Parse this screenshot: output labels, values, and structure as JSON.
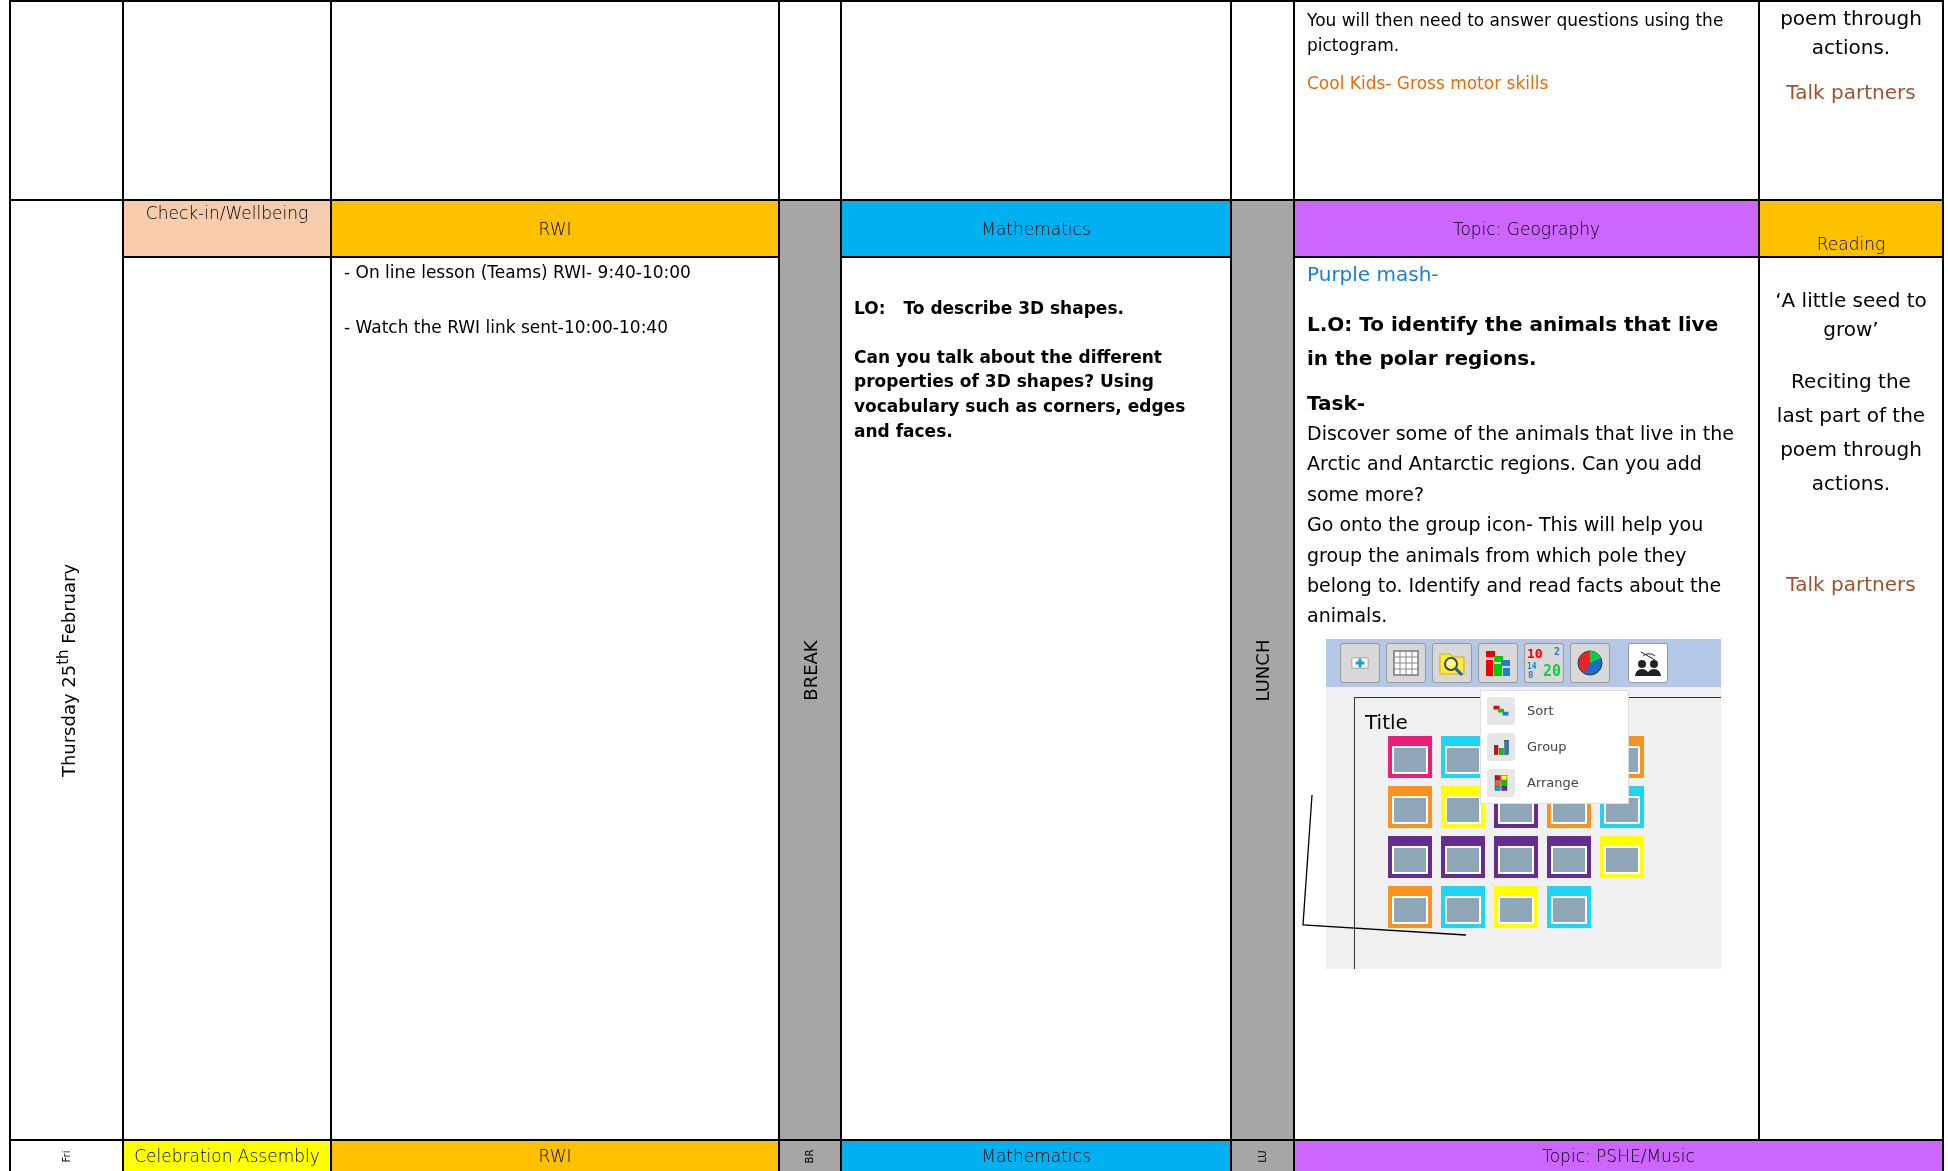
{
  "previous_row": {
    "topic_lines": [
      {
        "text": "You will then need to answer questions using the pictogram.",
        "kind": "plain"
      },
      {
        "text": "Cool Kids- Gross motor skills",
        "kind": "orange"
      }
    ],
    "reading_lines": [
      {
        "text": "poem through actions.",
        "kind": "plain"
      },
      {
        "text": "Talk partners",
        "kind": "brown"
      }
    ]
  },
  "thursday": {
    "day": "Thursday 25$^{th}$ February",
    "check_in": {
      "heading": "Check-in/Wellbeing"
    },
    "rwi": {
      "heading": "RWI",
      "lines": [
        "- On line lesson (Teams) RWI- 9:40-10:00",
        "- Watch the RWI link sent-10:00-10:40"
      ]
    },
    "break_label": "BREAK",
    "mathematics": {
      "heading": "Mathematics",
      "objective_label": "LO:",
      "objective": "To describe 3D shapes.",
      "question": "Can you talk about the different properties of 3D shapes? Using vocabulary such as corners, edges and faces."
    },
    "lunch_label": "LUNCH",
    "topic": {
      "heading": "Topic: Geography",
      "source": "Purple mash-",
      "objective": "L.O: To identify the animals that live in the polar regions.",
      "task_label": "Task-",
      "paragraphs": [
        "Discover some of the animals that live in the Arctic and Antarctic regions. Can you add some more?",
        "Go onto the group icon- This will help you group the animals from which pole they belong to. Identify and read facts about the animals."
      ],
      "screenshot": {
        "numbers": [
          "10",
          "2",
          "14",
          "8",
          "20"
        ],
        "menu": [
          {
            "label": "Sort",
            "kind": "sort"
          },
          {
            "label": "Group",
            "kind": "group"
          },
          {
            "label": "Arrange",
            "kind": "arrange"
          }
        ],
        "title": "Title",
        "cards": [
          {
            "color": "#ec1e79"
          },
          {
            "color": "#1fd6f2"
          },
          {
            "color": "#f7931e"
          },
          {
            "color": "#f7931e"
          },
          {
            "color": "#ffff00"
          },
          {
            "color": "#662d91"
          },
          {
            "color": "#f7931e"
          },
          {
            "color": "#1fd6f2"
          },
          {
            "color": "#662d91"
          },
          {
            "color": "#662d91"
          },
          {
            "color": "#662d91"
          },
          {
            "color": "#662d91"
          },
          {
            "color": "#ffff00"
          },
          {
            "color": "#f7931e"
          },
          {
            "color": "#1fd6f2"
          },
          {
            "color": "#ffff00"
          },
          {
            "color": "#1fd6f2"
          }
        ]
      }
    },
    "reading": {
      "heading": "Reading",
      "title": "‘A little seed to grow’",
      "description": "Reciting the last part of the poem through actions.",
      "note": "Talk partners"
    }
  },
  "friday": {
    "day": "Fri",
    "assembly": "Celebration Assembly",
    "rwi": "RWI",
    "break_label": "BR",
    "mathematics": "Mathematics",
    "lunch_label": "LU",
    "topic": "Topic:  PSHE/Music"
  }
}
